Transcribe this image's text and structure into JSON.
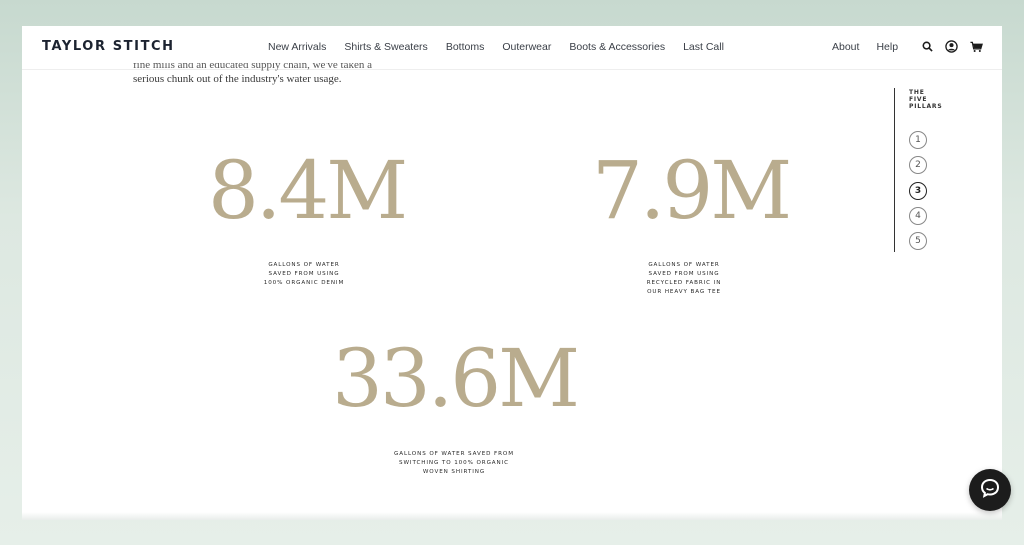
{
  "header": {
    "logo": "TAYLOR STITCH",
    "nav": [
      "New Arrivals",
      "Shirts & Sweaters",
      "Bottoms",
      "Outerwear",
      "Boots & Accessories",
      "Last Call"
    ],
    "right_links": [
      "About",
      "Help"
    ],
    "icons": [
      "search-icon",
      "account-icon",
      "cart-icon"
    ]
  },
  "intro": {
    "line_cut": "fine mills and an educated supply chain, we've taken a",
    "line": "serious chunk out of the industry's water usage."
  },
  "stats": [
    {
      "value": "8.4M",
      "label": [
        "GALLONS OF WATER",
        "SAVED FROM USING",
        "100% ORGANIC DENIM"
      ]
    },
    {
      "value": "7.9M",
      "label": [
        "GALLONS OF WATER",
        "SAVED FROM USING",
        "RECYCLED FABRIC IN",
        "OUR HEAVY BAG TEE"
      ]
    },
    {
      "value": "33.6M",
      "label": [
        "GALLONS OF WATER SAVED FROM",
        "SWITCHING TO 100% ORGANIC",
        "WOVEN SHIRTING"
      ]
    }
  ],
  "pillars": {
    "title": [
      "THE",
      "FIVE",
      "PILLARS"
    ],
    "items": [
      "1",
      "2",
      "3",
      "4",
      "5"
    ],
    "active": 3
  },
  "colors": {
    "stat_number": "#b9ac8e",
    "logo": "#1c2330",
    "chat_button": "#1c1c1c"
  }
}
